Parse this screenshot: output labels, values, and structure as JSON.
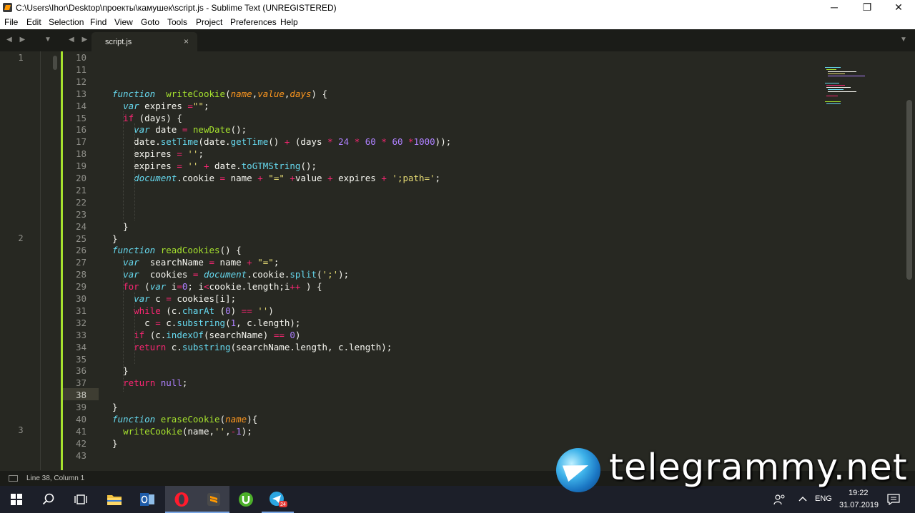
{
  "window": {
    "title": "C:\\Users\\Ihor\\Desktop\\проекты\\камушек\\script.js - Sublime Text (UNREGISTERED)",
    "controls": {
      "minimize": "─",
      "maximize": "❐",
      "close": "✕"
    }
  },
  "menu": [
    "File",
    "Edit",
    "Selection",
    "Find",
    "View",
    "Goto",
    "Tools",
    "Project",
    "Preferences",
    "Help"
  ],
  "tabs": {
    "nav_arrows": "◀ ▶",
    "dropdown": "▼",
    "active": "script.js",
    "close": "×"
  },
  "bookmarks": [
    {
      "label": "1",
      "line": 10
    },
    {
      "label": "2",
      "line": 25
    },
    {
      "label": "3",
      "line": 41
    }
  ],
  "line_numbers": [
    "10",
    "11",
    "12",
    "13",
    "14",
    "15",
    "16",
    "17",
    "18",
    "19",
    "20",
    "21",
    "22",
    "23",
    "24",
    "25",
    "26",
    "27",
    "28",
    "29",
    "30",
    "31",
    "32",
    "33",
    "34",
    "35",
    "36",
    "37",
    "38",
    "39",
    "40",
    "41",
    "42",
    "43"
  ],
  "current_line": "38",
  "code_lines": [
    [],
    [],
    [],
    [
      [
        "kw",
        "function"
      ],
      [
        "",
        "  "
      ],
      [
        "fn",
        "writeCookie"
      ],
      [
        "",
        "("
      ],
      [
        "pr",
        "name"
      ],
      [
        "",
        ","
      ],
      [
        "pr",
        "value"
      ],
      [
        "",
        ","
      ],
      [
        "pr",
        "days"
      ],
      [
        "",
        ") {"
      ]
    ],
    [
      [
        "",
        "  "
      ],
      [
        "kw",
        "var"
      ],
      [
        "",
        " expires "
      ],
      [
        "k2",
        "="
      ],
      [
        "st",
        "\"\""
      ],
      [
        "",
        ";"
      ]
    ],
    [
      [
        "",
        "  "
      ],
      [
        "k2",
        "if"
      ],
      [
        "",
        " (days) {"
      ]
    ],
    [
      [
        "",
        "    "
      ],
      [
        "kw",
        "var"
      ],
      [
        "",
        " date "
      ],
      [
        "k2",
        "="
      ],
      [
        "",
        ""
      ],
      [
        "",
        " "
      ],
      [
        "fn",
        "newDate"
      ],
      [
        "",
        "();"
      ]
    ],
    [
      [
        "",
        "    date."
      ],
      [
        "md",
        "setTime"
      ],
      [
        "",
        "(date."
      ],
      [
        "md",
        "getTime"
      ],
      [
        "",
        "() "
      ],
      [
        "k2",
        "+"
      ],
      [
        "",
        " (days "
      ],
      [
        "k2",
        "*"
      ],
      [
        "",
        " "
      ],
      [
        "nu",
        "24"
      ],
      [
        "",
        " "
      ],
      [
        "k2",
        "*"
      ],
      [
        "",
        " "
      ],
      [
        "nu",
        "60"
      ],
      [
        "",
        " "
      ],
      [
        "k2",
        "*"
      ],
      [
        "",
        " "
      ],
      [
        "nu",
        "60"
      ],
      [
        "",
        " "
      ],
      [
        "k2",
        "*"
      ],
      [
        "nu",
        "1000"
      ],
      [
        "",
        "));"
      ]
    ],
    [
      [
        "",
        "    expires "
      ],
      [
        "k2",
        "="
      ],
      [
        "",
        " "
      ],
      [
        "st",
        "''"
      ],
      [
        "",
        ";"
      ]
    ],
    [
      [
        "",
        "    expires "
      ],
      [
        "k2",
        "="
      ],
      [
        "",
        " "
      ],
      [
        "st",
        "''"
      ],
      [
        "",
        " "
      ],
      [
        "k2",
        "+"
      ],
      [
        "",
        " date."
      ],
      [
        "md",
        "toGTMString"
      ],
      [
        "",
        "();"
      ]
    ],
    [
      [
        "",
        "    "
      ],
      [
        "ob",
        "document"
      ],
      [
        "",
        ".cookie "
      ],
      [
        "k2",
        "="
      ],
      [
        "",
        " name "
      ],
      [
        "k2",
        "+"
      ],
      [
        "",
        " "
      ],
      [
        "st",
        "\"=\""
      ],
      [
        "",
        " "
      ],
      [
        "k2",
        "+"
      ],
      [
        "",
        "value "
      ],
      [
        "k2",
        "+"
      ],
      [
        "",
        " expires "
      ],
      [
        "k2",
        "+"
      ],
      [
        "",
        " "
      ],
      [
        "st",
        "';path='"
      ],
      [
        "",
        ";"
      ]
    ],
    [],
    [],
    [],
    [
      [
        "",
        "  }"
      ]
    ],
    [
      [
        "",
        "}"
      ]
    ],
    [
      [
        "kw",
        "function"
      ],
      [
        "",
        " "
      ],
      [
        "fn",
        "readCookies"
      ],
      [
        "",
        "() {"
      ]
    ],
    [
      [
        "",
        "  "
      ],
      [
        "kw",
        "var"
      ],
      [
        "",
        "  searchName "
      ],
      [
        "k2",
        "="
      ],
      [
        "",
        " name "
      ],
      [
        "k2",
        "+"
      ],
      [
        "",
        " "
      ],
      [
        "st",
        "\"=\""
      ],
      [
        "",
        ";"
      ]
    ],
    [
      [
        "",
        "  "
      ],
      [
        "kw",
        "var"
      ],
      [
        "",
        "  cookies "
      ],
      [
        "k2",
        "="
      ],
      [
        "",
        " "
      ],
      [
        "ob",
        "document"
      ],
      [
        "",
        ".cookie."
      ],
      [
        "md",
        "split"
      ],
      [
        "",
        "("
      ],
      [
        "st",
        "';'"
      ],
      [
        "",
        ");"
      ]
    ],
    [
      [
        "",
        "  "
      ],
      [
        "k2",
        "for"
      ],
      [
        "",
        " ("
      ],
      [
        "kw",
        "var"
      ],
      [
        "",
        " i"
      ],
      [
        "k2",
        "="
      ],
      [
        "nu",
        "0"
      ],
      [
        "",
        "; i"
      ],
      [
        "k2",
        "<"
      ],
      [
        "",
        "cookie.length;i"
      ],
      [
        "k2",
        "++"
      ],
      [
        "",
        " ) {"
      ]
    ],
    [
      [
        "",
        "    "
      ],
      [
        "kw",
        "var"
      ],
      [
        "",
        " c "
      ],
      [
        "k2",
        "="
      ],
      [
        "",
        " cookies[i];"
      ]
    ],
    [
      [
        "",
        "    "
      ],
      [
        "k2",
        "while"
      ],
      [
        "",
        " (c."
      ],
      [
        "md",
        "charAt"
      ],
      [
        "",
        " ("
      ],
      [
        "nu",
        "0"
      ],
      [
        "",
        ") "
      ],
      [
        "k2",
        "=="
      ],
      [
        "",
        " "
      ],
      [
        "st",
        "''"
      ],
      [
        "",
        ")"
      ]
    ],
    [
      [
        "",
        "      c "
      ],
      [
        "k2",
        "="
      ],
      [
        "",
        " c."
      ],
      [
        "md",
        "substring"
      ],
      [
        "",
        "("
      ],
      [
        "nu",
        "1"
      ],
      [
        "",
        ", c.length);"
      ]
    ],
    [
      [
        "",
        "    "
      ],
      [
        "k2",
        "if"
      ],
      [
        "",
        " (c."
      ],
      [
        "md",
        "indexOf"
      ],
      [
        "",
        "(searchName) "
      ],
      [
        "k2",
        "=="
      ],
      [
        "",
        " "
      ],
      [
        "nu",
        "0"
      ],
      [
        "",
        ")"
      ]
    ],
    [
      [
        "",
        "    "
      ],
      [
        "k2",
        "return"
      ],
      [
        "",
        " c."
      ],
      [
        "md",
        "substring"
      ],
      [
        "",
        "(searchName.length, c.length);"
      ]
    ],
    [],
    [
      [
        "",
        "  }"
      ]
    ],
    [
      [
        "",
        "  "
      ],
      [
        "k2",
        "return"
      ],
      [
        "",
        " "
      ],
      [
        "nu",
        "null"
      ],
      [
        "",
        ";"
      ]
    ],
    [],
    [
      [
        "",
        "}"
      ]
    ],
    [
      [
        "kw",
        "function"
      ],
      [
        "",
        " "
      ],
      [
        "fn",
        "eraseCookie"
      ],
      [
        "",
        "("
      ],
      [
        "pr",
        "name"
      ],
      [
        "",
        "){"
      ]
    ],
    [
      [
        "",
        "  "
      ],
      [
        "fn",
        "writeCookie"
      ],
      [
        "",
        "(name,"
      ],
      [
        "st",
        "''"
      ],
      [
        "",
        ","
      ],
      [
        "k2",
        "-"
      ],
      [
        "nu",
        "1"
      ],
      [
        "",
        ");"
      ]
    ],
    [
      [
        "",
        "}"
      ]
    ],
    []
  ],
  "status": {
    "position": "Line 38, Column 1"
  },
  "taskbar": {
    "icons": [
      "windows-start-icon",
      "search-icon",
      "task-view-icon",
      "file-explorer-icon",
      "outlook-icon",
      "opera-icon",
      "sublime-text-icon",
      "utorrent-icon",
      "telegram-icon"
    ],
    "telegram_badge": "24",
    "language": "ENG",
    "time": "19:22",
    "date": "31.07.2019"
  },
  "watermark": {
    "text": "telegrammy.net"
  },
  "colors": {
    "background": "#272822",
    "keyword": "#66d9ef",
    "operator": "#f92672",
    "function": "#a6e22e",
    "param": "#fd971f",
    "string": "#e6db74",
    "number": "#ae81ff"
  }
}
